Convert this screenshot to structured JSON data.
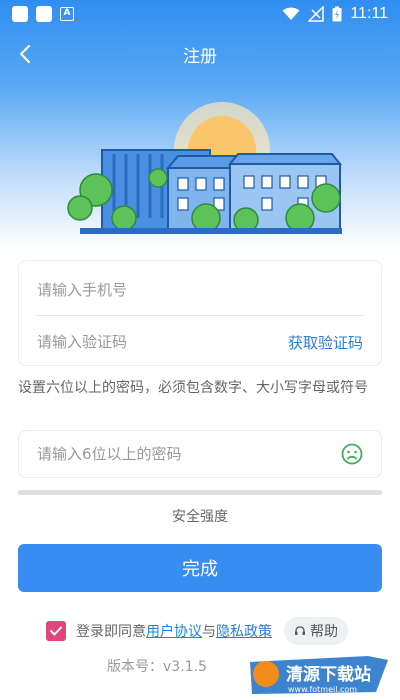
{
  "status_bar": {
    "time": "11:11",
    "app_icon_letter": "A"
  },
  "nav": {
    "title": "注册"
  },
  "phone": {
    "placeholder": "请输入手机号"
  },
  "code": {
    "placeholder": "请输入验证码",
    "get_code_label": "获取验证码"
  },
  "password_hint": "设置六位以上的密码，必须包含数字、大小写字母或符号",
  "password": {
    "placeholder": "请输入6位以上的密码"
  },
  "strength": {
    "label": "安全强度",
    "level": 0
  },
  "submit": {
    "label": "完成"
  },
  "agreement": {
    "checked": true,
    "prefix": "登录即同意",
    "terms_link": "用户协议",
    "joiner": "与",
    "privacy_link": "隐私政策",
    "help_label": "帮助"
  },
  "version": {
    "label": "版本号：v3.1.5"
  },
  "watermark": {
    "text": "清源下载站",
    "url_text": "www.fotmeil.com"
  },
  "colors": {
    "accent": "#3a8df0",
    "link": "#2a7ed8",
    "checkbox": "#e0457b",
    "face": "#3fae5c"
  },
  "icons": {
    "back": "chevron-left-icon",
    "face": "sad-face-icon",
    "help": "headset-icon",
    "check": "check-icon"
  }
}
